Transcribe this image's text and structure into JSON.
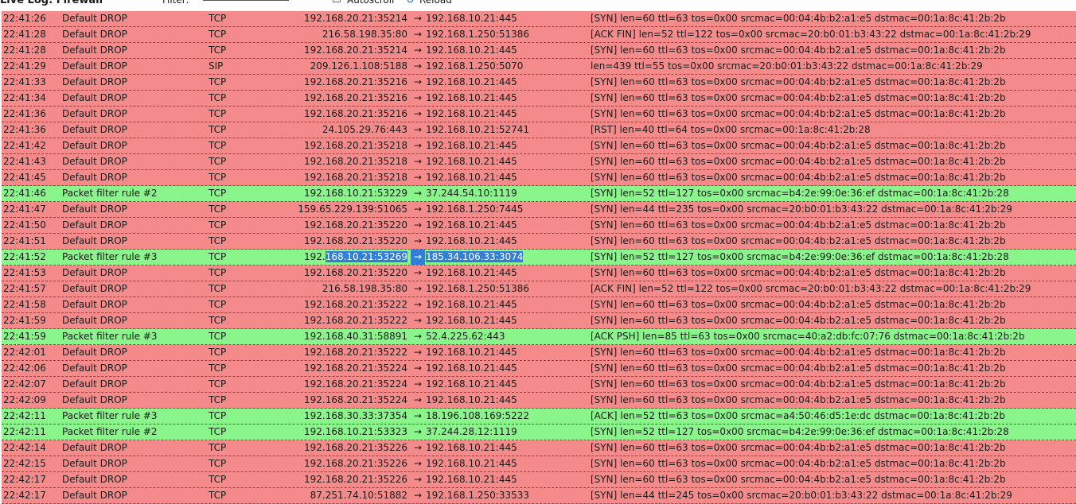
{
  "header": {
    "title": "Live Log: Firewall",
    "filter_label": "Filter:",
    "filter_value": "",
    "autoscroll_label": "Autoscroll",
    "autoscroll_checked": true,
    "reload_label": "Reload"
  },
  "colors": {
    "drop_row": "#f58a8a",
    "pass_row": "#8af58a",
    "selection": "#2f7fd6"
  },
  "log_rows": [
    {
      "time": "22:41:26",
      "rule": "Default DROP",
      "proto": "TCP",
      "src": "192.168.20.21:35214",
      "dst": "192.168.10.21:445",
      "info": "[SYN]  len=60  ttl=63  tos=0x00  srcmac=00:04:4b:b2:a1:e5  dstmac=00:1a:8c:41:2b:2b",
      "action": "drop"
    },
    {
      "time": "22:41:28",
      "rule": "Default DROP",
      "proto": "TCP",
      "src": "216.58.198.35:80",
      "dst": "192.168.1.250:51386",
      "info": "[ACK FIN]  len=52  ttl=122  tos=0x00  srcmac=20:b0:01:b3:43:22  dstmac=00:1a:8c:41:2b:29",
      "action": "drop"
    },
    {
      "time": "22:41:28",
      "rule": "Default DROP",
      "proto": "TCP",
      "src": "192.168.20.21:35214",
      "dst": "192.168.10.21:445",
      "info": "[SYN]  len=60  ttl=63  tos=0x00  srcmac=00:04:4b:b2:a1:e5  dstmac=00:1a:8c:41:2b:2b",
      "action": "drop"
    },
    {
      "time": "22:41:29",
      "rule": "Default DROP",
      "proto": "SIP",
      "src": "209.126.1.108:5188",
      "dst": "192.168.1.250:5070",
      "info": "len=439  ttl=55  tos=0x00  srcmac=20:b0:01:b3:43:22  dstmac=00:1a:8c:41:2b:29",
      "action": "drop"
    },
    {
      "time": "22:41:33",
      "rule": "Default DROP",
      "proto": "TCP",
      "src": "192.168.20.21:35216",
      "dst": "192.168.10.21:445",
      "info": "[SYN]  len=60  ttl=63  tos=0x00  srcmac=00:04:4b:b2:a1:e5  dstmac=00:1a:8c:41:2b:2b",
      "action": "drop"
    },
    {
      "time": "22:41:34",
      "rule": "Default DROP",
      "proto": "TCP",
      "src": "192.168.20.21:35216",
      "dst": "192.168.10.21:445",
      "info": "[SYN]  len=60  ttl=63  tos=0x00  srcmac=00:04:4b:b2:a1:e5  dstmac=00:1a:8c:41:2b:2b",
      "action": "drop"
    },
    {
      "time": "22:41:36",
      "rule": "Default DROP",
      "proto": "TCP",
      "src": "192.168.20.21:35216",
      "dst": "192.168.10.21:445",
      "info": "[SYN]  len=60  ttl=63  tos=0x00  srcmac=00:04:4b:b2:a1:e5  dstmac=00:1a:8c:41:2b:2b",
      "action": "drop"
    },
    {
      "time": "22:41:36",
      "rule": "Default DROP",
      "proto": "TCP",
      "src": "24.105.29.76:443",
      "dst": "192.168.10.21:52741",
      "info": "[RST]  len=40  ttl=64  tos=0x00  srcmac=00:1a:8c:41:2b:28",
      "action": "drop"
    },
    {
      "time": "22:41:42",
      "rule": "Default DROP",
      "proto": "TCP",
      "src": "192.168.20.21:35218",
      "dst": "192.168.10.21:445",
      "info": "[SYN]  len=60  ttl=63  tos=0x00  srcmac=00:04:4b:b2:a1:e5  dstmac=00:1a:8c:41:2b:2b",
      "action": "drop"
    },
    {
      "time": "22:41:43",
      "rule": "Default DROP",
      "proto": "TCP",
      "src": "192.168.20.21:35218",
      "dst": "192.168.10.21:445",
      "info": "[SYN]  len=60  ttl=63  tos=0x00  srcmac=00:04:4b:b2:a1:e5  dstmac=00:1a:8c:41:2b:2b",
      "action": "drop"
    },
    {
      "time": "22:41:45",
      "rule": "Default DROP",
      "proto": "TCP",
      "src": "192.168.20.21:35218",
      "dst": "192.168.10.21:445",
      "info": "[SYN]  len=60  ttl=63  tos=0x00  srcmac=00:04:4b:b2:a1:e5  dstmac=00:1a:8c:41:2b:2b",
      "action": "drop"
    },
    {
      "time": "22:41:46",
      "rule": "Packet filter rule #2",
      "proto": "TCP",
      "src": "192.168.10.21:53229",
      "dst": "37.244.54.10:1119",
      "info": "[SYN]  len=52  ttl=127  tos=0x00  srcmac=b4:2e:99:0e:36:ef  dstmac=00:1a:8c:41:2b:28",
      "action": "pass"
    },
    {
      "time": "22:41:47",
      "rule": "Default DROP",
      "proto": "TCP",
      "src": "159.65.229.139:51065",
      "dst": "192.168.1.250:7445",
      "info": "[SYN]  len=44  ttl=235  tos=0x00  srcmac=20:b0:01:b3:43:22  dstmac=00:1a:8c:41:2b:29",
      "action": "drop"
    },
    {
      "time": "22:41:50",
      "rule": "Default DROP",
      "proto": "TCP",
      "src": "192.168.20.21:35220",
      "dst": "192.168.10.21:445",
      "info": "[SYN]  len=60  ttl=63  tos=0x00  srcmac=00:04:4b:b2:a1:e5  dstmac=00:1a:8c:41:2b:2b",
      "action": "drop"
    },
    {
      "time": "22:41:51",
      "rule": "Default DROP",
      "proto": "TCP",
      "src": "192.168.20.21:35220",
      "dst": "192.168.10.21:445",
      "info": "[SYN]  len=60  ttl=63  tos=0x00  srcmac=00:04:4b:b2:a1:e5  dstmac=00:1a:8c:41:2b:2b",
      "action": "drop"
    },
    {
      "time": "22:41:52",
      "rule": "Packet filter rule #3",
      "proto": "TCP",
      "src": "192.168.10.21:53269",
      "src_plain": "192.",
      "src_selected": "168.10.21:53269",
      "dst": "185.34.106.33:3074",
      "info": "[SYN]  len=52  ttl=127  tos=0x00  srcmac=b4:2e:99:0e:36:ef  dstmac=00:1a:8c:41:2b:28",
      "action": "pass",
      "selected": true
    },
    {
      "time": "22:41:53",
      "rule": "Default DROP",
      "proto": "TCP",
      "src": "192.168.20.21:35220",
      "dst": "192.168.10.21:445",
      "info": "[SYN]  len=60  ttl=63  tos=0x00  srcmac=00:04:4b:b2:a1:e5  dstmac=00:1a:8c:41:2b:2b",
      "action": "drop"
    },
    {
      "time": "22:41:57",
      "rule": "Default DROP",
      "proto": "TCP",
      "src": "216.58.198.35:80",
      "dst": "192.168.1.250:51386",
      "info": "[ACK FIN]  len=52  ttl=122  tos=0x00  srcmac=20:b0:01:b3:43:22  dstmac=00:1a:8c:41:2b:29",
      "action": "drop"
    },
    {
      "time": "22:41:58",
      "rule": "Default DROP",
      "proto": "TCP",
      "src": "192.168.20.21:35222",
      "dst": "192.168.10.21:445",
      "info": "[SYN]  len=60  ttl=63  tos=0x00  srcmac=00:04:4b:b2:a1:e5  dstmac=00:1a:8c:41:2b:2b",
      "action": "drop"
    },
    {
      "time": "22:41:59",
      "rule": "Default DROP",
      "proto": "TCP",
      "src": "192.168.20.21:35222",
      "dst": "192.168.10.21:445",
      "info": "[SYN]  len=60  ttl=63  tos=0x00  srcmac=00:04:4b:b2:a1:e5  dstmac=00:1a:8c:41:2b:2b",
      "action": "drop"
    },
    {
      "time": "22:41:59",
      "rule": "Packet filter rule #3",
      "proto": "TCP",
      "src": "192.168.40.31:58891",
      "dst": "52.4.225.62:443",
      "info": "[ACK PSH]  len=85  ttl=63  tos=0x00  srcmac=40:a2:db:fc:07:76  dstmac=00:1a:8c:41:2b:2b",
      "action": "pass"
    },
    {
      "time": "22:42:01",
      "rule": "Default DROP",
      "proto": "TCP",
      "src": "192.168.20.21:35222",
      "dst": "192.168.10.21:445",
      "info": "[SYN]  len=60  ttl=63  tos=0x00  srcmac=00:04:4b:b2:a1:e5  dstmac=00:1a:8c:41:2b:2b",
      "action": "drop"
    },
    {
      "time": "22:42:06",
      "rule": "Default DROP",
      "proto": "TCP",
      "src": "192.168.20.21:35224",
      "dst": "192.168.10.21:445",
      "info": "[SYN]  len=60  ttl=63  tos=0x00  srcmac=00:04:4b:b2:a1:e5  dstmac=00:1a:8c:41:2b:2b",
      "action": "drop"
    },
    {
      "time": "22:42:07",
      "rule": "Default DROP",
      "proto": "TCP",
      "src": "192.168.20.21:35224",
      "dst": "192.168.10.21:445",
      "info": "[SYN]  len=60  ttl=63  tos=0x00  srcmac=00:04:4b:b2:a1:e5  dstmac=00:1a:8c:41:2b:2b",
      "action": "drop"
    },
    {
      "time": "22:42:09",
      "rule": "Default DROP",
      "proto": "TCP",
      "src": "192.168.20.21:35224",
      "dst": "192.168.10.21:445",
      "info": "[SYN]  len=60  ttl=63  tos=0x00  srcmac=00:04:4b:b2:a1:e5  dstmac=00:1a:8c:41:2b:2b",
      "action": "drop"
    },
    {
      "time": "22:42:11",
      "rule": "Packet filter rule #3",
      "proto": "TCP",
      "src": "192.168.30.33:37354",
      "dst": "18.196.108.169:5222",
      "info": "[ACK]  len=52  ttl=63  tos=0x00  srcmac=a4:50:46:d5:1e:dc  dstmac=00:1a:8c:41:2b:2b",
      "action": "pass"
    },
    {
      "time": "22:42:11",
      "rule": "Packet filter rule #2",
      "proto": "TCP",
      "src": "192.168.10.21:53323",
      "dst": "37.244.28.12:1119",
      "info": "[SYN]  len=52  ttl=127  tos=0x00  srcmac=b4:2e:99:0e:36:ef  dstmac=00:1a:8c:41:2b:28",
      "action": "pass"
    },
    {
      "time": "22:42:14",
      "rule": "Default DROP",
      "proto": "TCP",
      "src": "192.168.20.21:35226",
      "dst": "192.168.10.21:445",
      "info": "[SYN]  len=60  ttl=63  tos=0x00  srcmac=00:04:4b:b2:a1:e5  dstmac=00:1a:8c:41:2b:2b",
      "action": "drop"
    },
    {
      "time": "22:42:15",
      "rule": "Default DROP",
      "proto": "TCP",
      "src": "192.168.20.21:35226",
      "dst": "192.168.10.21:445",
      "info": "[SYN]  len=60  ttl=63  tos=0x00  srcmac=00:04:4b:b2:a1:e5  dstmac=00:1a:8c:41:2b:2b",
      "action": "drop"
    },
    {
      "time": "22:42:17",
      "rule": "Default DROP",
      "proto": "TCP",
      "src": "192.168.20.21:35226",
      "dst": "192.168.10.21:445",
      "info": "[SYN]  len=60  ttl=63  tos=0x00  srcmac=00:04:4b:b2:a1:e5  dstmac=00:1a:8c:41:2b:2b",
      "action": "drop"
    },
    {
      "time": "22:42:17",
      "rule": "Default DROP",
      "proto": "TCP",
      "src": "87.251.74.10:51882",
      "dst": "192.168.1.250:33533",
      "info": "[SYN]  len=44  ttl=245  tos=0x00  srcmac=20:b0:01:b3:43:22  dstmac=00:1a:8c:41:2b:29",
      "action": "drop"
    }
  ],
  "arrow_glyph": "→"
}
